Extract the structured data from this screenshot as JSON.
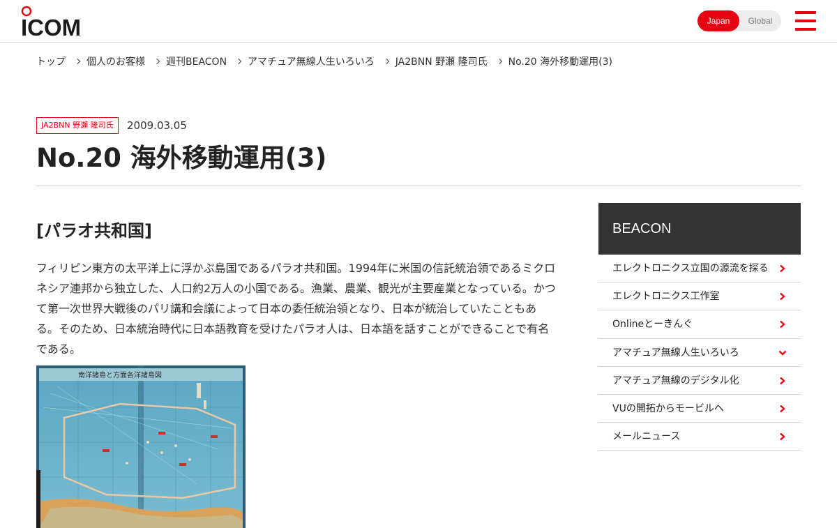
{
  "header": {
    "logo_text": "ICOM",
    "lang_active": "Japan",
    "lang_inactive": "Global",
    "brand_color": "#e60012"
  },
  "breadcrumb": [
    "トップ",
    "個人のお客様",
    "週刊BEACON",
    "アマチュア無線人生いろいろ",
    "JA2BNN 野瀬 隆司氏",
    "No.20 海外移動運用(3)"
  ],
  "article": {
    "author_tag": "JA2BNN 野瀬 隆司氏",
    "date": "2009.03.05",
    "title": "No.20 海外移動運用(3)",
    "section_heading": "[パラオ共和国]",
    "paragraph": "フィリピン東方の太平洋上に浮かぶ島国であるパラオ共和国。1994年に米国の信託統治領であるミクロネシア連邦から独立した、人口約2万人の小国である。漁業、農業、観光が主要産業となっている。かつて第一次世界大戦後のパリ講和会議によって日本の委任統治領となり、日本が統治していたこともある。そのため、日本統治時代に日本語教育を受けたパラオ人は、日本語を話すことができることで有名である。",
    "photo_map_title": "南洋諸島と方面各洋諸島図"
  },
  "sidebar": {
    "title": "BEACON",
    "items": [
      {
        "label": "エレクトロニクス立国の源流を探る",
        "icon": "chevron-right-icon"
      },
      {
        "label": "エレクトロニクス工作室",
        "icon": "chevron-right-icon"
      },
      {
        "label": "Onlineとーきんぐ",
        "icon": "chevron-right-icon"
      },
      {
        "label": "アマチュア無線人生いろいろ",
        "icon": "chevron-down-icon"
      },
      {
        "label": "アマチュア無線のデジタル化",
        "icon": "chevron-right-icon"
      },
      {
        "label": "VUの開拓からモービルへ",
        "icon": "chevron-right-icon"
      },
      {
        "label": "メールニュース",
        "icon": "chevron-right-icon"
      }
    ]
  }
}
